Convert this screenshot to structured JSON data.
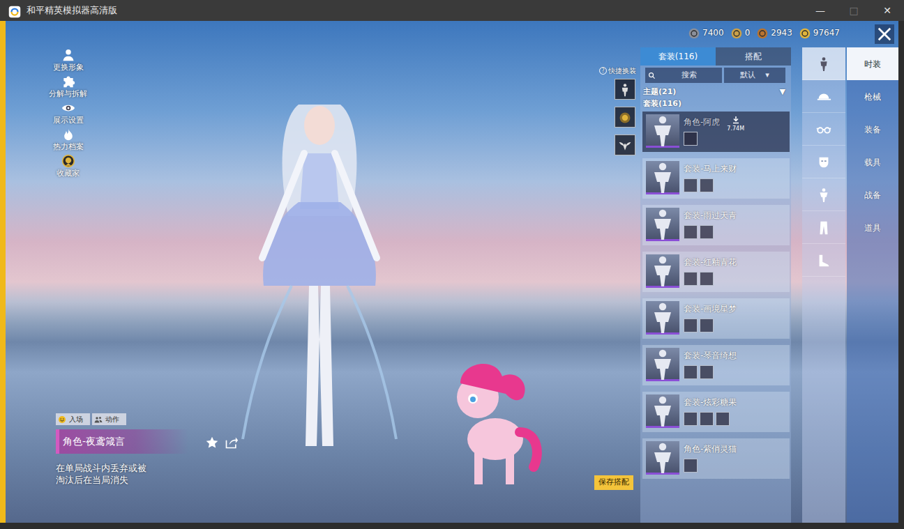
{
  "window": {
    "title": "和平精英模拟器高清版",
    "controls": [
      {
        "label": "—",
        "disabled": false
      },
      {
        "label": "□",
        "disabled": true
      },
      {
        "label": "✕",
        "disabled": false
      }
    ]
  },
  "currencies": [
    {
      "amount": "7400",
      "color": "#8a8f9a"
    },
    {
      "amount": "0",
      "color": "#c9a04a"
    },
    {
      "amount": "2943",
      "color": "#b8732f"
    },
    {
      "amount": "97647",
      "color": "#e0b43c"
    }
  ],
  "left_menu": [
    {
      "label": "更换形象",
      "kind": "avatar"
    },
    {
      "label": "分解与拆解",
      "kind": "puzzle"
    },
    {
      "label": "展示设置",
      "kind": "eye"
    },
    {
      "label": "热力档案",
      "kind": "flame"
    },
    {
      "label": "收藏家",
      "kind": "badge"
    }
  ],
  "quick_change": {
    "help": "?",
    "label": "快捷换装",
    "slots": [
      {
        "kind": "outfit"
      },
      {
        "kind": "emblem"
      },
      {
        "kind": "wings"
      }
    ]
  },
  "panel": {
    "tabs": [
      {
        "label": "套装(116)",
        "selected": true
      },
      {
        "label": "搭配",
        "selected": false
      }
    ],
    "search": {
      "placeholder": "搜索"
    },
    "sort": {
      "label": "默认",
      "arrow": "▾"
    },
    "theme": {
      "label": "主题(21)",
      "arrow": "▼"
    },
    "section": "套装(116)",
    "items": [
      {
        "name": "角色-阿虎",
        "parts": 1,
        "selected": true,
        "download": "7.74M"
      },
      {
        "name": "套装-马上来财",
        "parts": 2,
        "selected": false
      },
      {
        "name": "套装-雨过天青",
        "parts": 2,
        "selected": false
      },
      {
        "name": "套装-红釉青花",
        "parts": 2,
        "selected": false
      },
      {
        "name": "套装-画境星梦",
        "parts": 2,
        "selected": false
      },
      {
        "name": "套装-琴音绮想",
        "parts": 2,
        "selected": false
      },
      {
        "name": "套装-炫彩糖果",
        "parts": 3,
        "selected": false
      },
      {
        "name": "角色-紫俏灵猫",
        "parts": 1,
        "selected": false
      }
    ]
  },
  "categories": [
    {
      "kind": "outfit",
      "selected": true
    },
    {
      "kind": "cap",
      "selected": false
    },
    {
      "kind": "glasses",
      "selected": false
    },
    {
      "kind": "mask",
      "selected": false
    },
    {
      "kind": "top",
      "selected": false
    },
    {
      "kind": "pants",
      "selected": false
    },
    {
      "kind": "shoes",
      "selected": false
    }
  ],
  "right_tabs": [
    {
      "label": "时装",
      "selected": true
    },
    {
      "label": "枪械",
      "selected": false
    },
    {
      "label": "装备",
      "selected": false
    },
    {
      "label": "载具",
      "selected": false
    },
    {
      "label": "战备",
      "selected": false
    },
    {
      "label": "道具",
      "selected": false
    }
  ],
  "bottom": {
    "buttons": [
      {
        "label": "入场",
        "kind": "smile"
      },
      {
        "label": "动作",
        "kind": "people"
      }
    ],
    "name": "角色-夜鸢箴言",
    "description": "在单局战斗内丢弃或被淘汰后在当局消失"
  },
  "save_button": "保存搭配"
}
